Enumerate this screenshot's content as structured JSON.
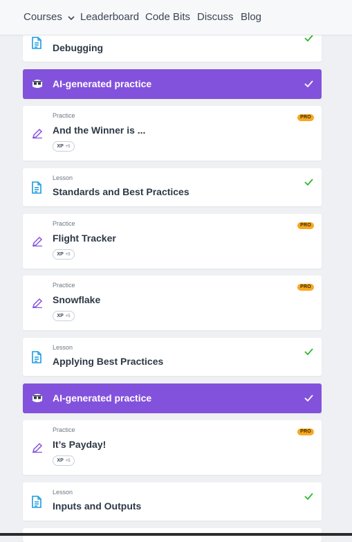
{
  "nav": {
    "courses": "Courses",
    "leaderboard": "Leaderboard",
    "code_bits": "Code Bits",
    "discuss": "Discuss",
    "blog": "Blog"
  },
  "colors": {
    "accent_purple": "#8352dc",
    "lesson_blue": "#1a9ae0",
    "practice_purple": "#8352dc",
    "check_green": "#2eb82e",
    "pro_orange": "#f7a823"
  },
  "items": [
    {
      "type": "lesson",
      "kind": "",
      "title": "Debugging",
      "completed": true
    },
    {
      "type": "ai",
      "title": "AI-generated practice",
      "completed": true
    },
    {
      "type": "practice",
      "kind": "Practice",
      "title": "And the Winner is ...",
      "pro": "PRO",
      "xp_label": "XP",
      "xp_value": "+5"
    },
    {
      "type": "lesson",
      "kind": "Lesson",
      "title": "Standards and Best Practices",
      "completed": true
    },
    {
      "type": "practice",
      "kind": "Practice",
      "title": "Flight Tracker",
      "pro": "PRO",
      "xp_label": "XP",
      "xp_value": "+5"
    },
    {
      "type": "practice",
      "kind": "Practice",
      "title": "Snowflake",
      "pro": "PRO",
      "xp_label": "XP",
      "xp_value": "+5"
    },
    {
      "type": "lesson",
      "kind": "Lesson",
      "title": "Applying Best Practices",
      "completed": true
    },
    {
      "type": "ai",
      "title": "AI-generated practice",
      "completed": true
    },
    {
      "type": "practice",
      "kind": "Practice",
      "title": "It’s Payday!",
      "pro": "PRO",
      "xp_label": "XP",
      "xp_value": "+5"
    },
    {
      "type": "lesson",
      "kind": "Lesson",
      "title": "Inputs and Outputs",
      "completed": true
    }
  ]
}
